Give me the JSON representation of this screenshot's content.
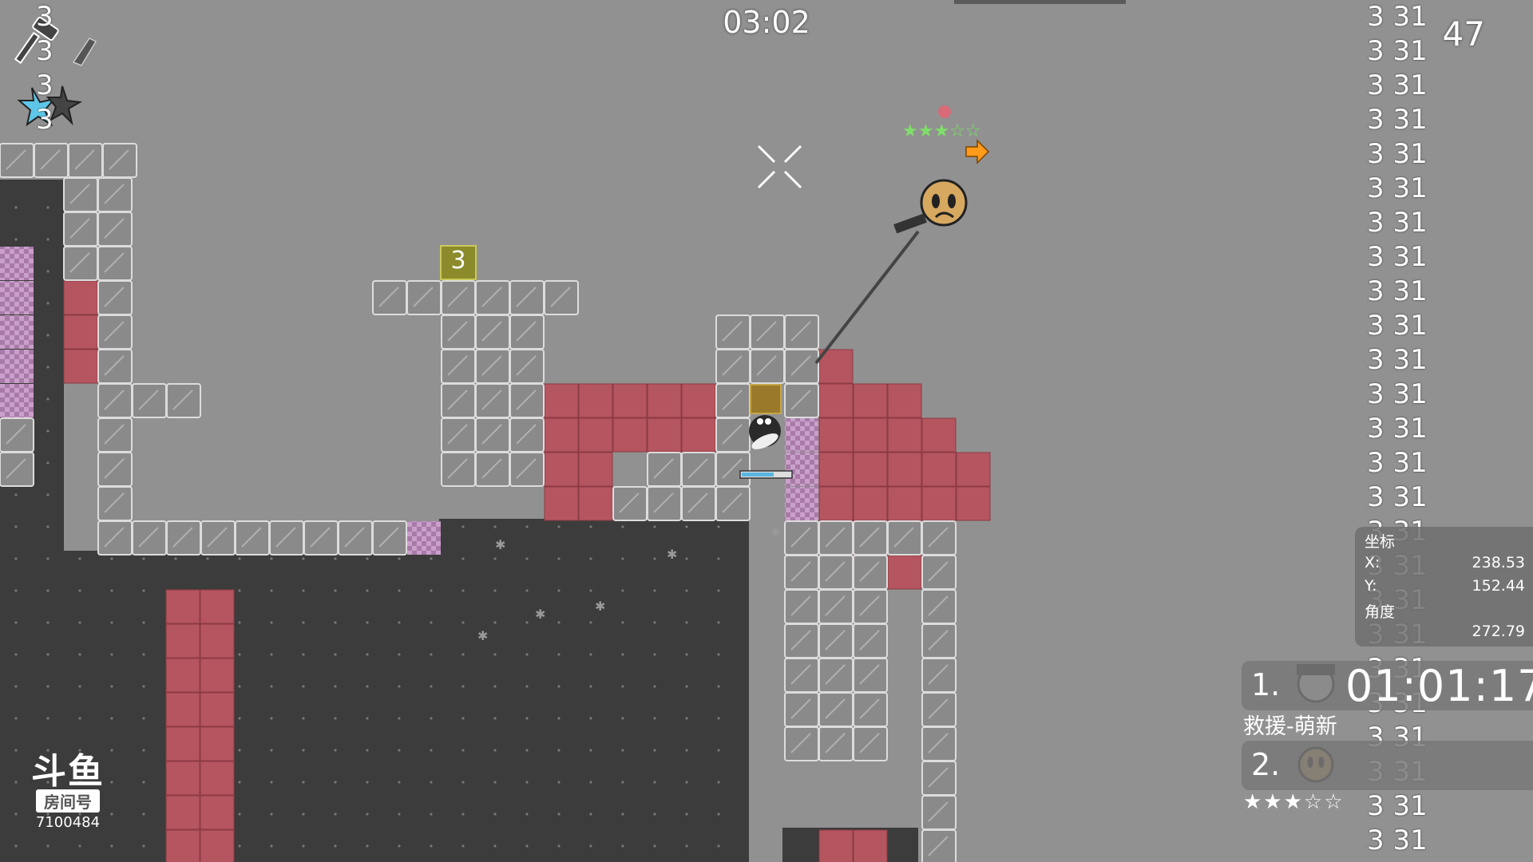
{
  "hud": {
    "timer": "03:02",
    "fps": "47",
    "checkpoint_number": "3",
    "top_left_digits": [
      "3",
      "3",
      "3",
      "3"
    ]
  },
  "debug_column": {
    "lines": [
      "3 31",
      "3 31",
      "3 31",
      "3 31",
      "3 31",
      "3 31",
      "3 31",
      "3 31",
      "3 31",
      "3 31",
      "3 31",
      "3 31",
      "3 31",
      "3 31",
      "3 31",
      "3 31",
      "3 31",
      "3 31",
      "3 31",
      "3 31",
      "3 31",
      "3 31",
      "3 31",
      "3 31",
      "3 31"
    ]
  },
  "coords": {
    "title": "坐标",
    "x_label": "X:",
    "x_value": "238.53",
    "y_label": "Y:",
    "y_value": "152.44",
    "angle_label": "角度",
    "angle_value": "272.79"
  },
  "ranking": [
    {
      "rank": "1.",
      "time": "01:01:17",
      "name": "救援-萌新"
    },
    {
      "rank": "2.",
      "stars": "★★★☆☆"
    }
  ],
  "player": {
    "stars": "★★★☆☆"
  },
  "watermark": {
    "brand": "斗鱼",
    "tag": "房间号",
    "room": "7100484"
  },
  "colors": {
    "background": "#919191",
    "dark_fill": "#3c3c3c",
    "freeze_tile": "#b5555f",
    "unhook_tile": "#a87aa8",
    "block_tile": "#8a8a8a",
    "player_body": "#d6a860",
    "hook_line": "#444444",
    "stars_green": "#7ee06a"
  },
  "icons": [
    "hammer-icon",
    "gun-icon",
    "ninja-star-icon",
    "crosshair-icon",
    "arrow-right-icon",
    "avatar-icon"
  ]
}
